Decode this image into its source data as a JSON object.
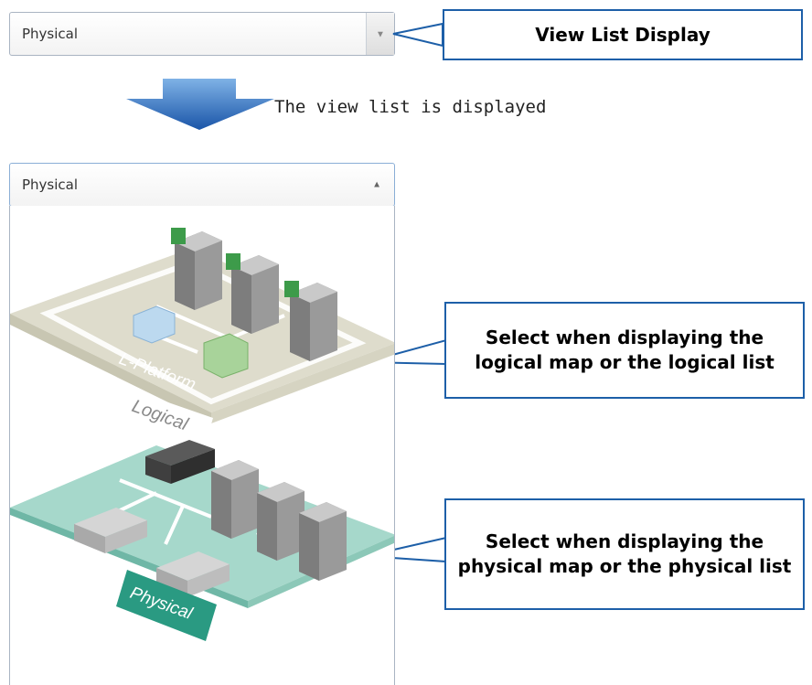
{
  "top_select": {
    "value": "Physical"
  },
  "transition": {
    "caption": "The view list is displayed"
  },
  "open_select": {
    "value": "Physical"
  },
  "view_options": {
    "logical_title": "Logical",
    "lplatform_label": "L-Platform",
    "physical_title": "Physical"
  },
  "callouts": {
    "view_list": "View List Display",
    "logical": "Select when displaying the logical map or the logical list",
    "physical": "Select when displaying the physical map or the physical list"
  },
  "colors": {
    "accent": "#1d5fa8",
    "logical_layer": "#e3e1d3",
    "physical_layer": "#9fd3c6"
  }
}
